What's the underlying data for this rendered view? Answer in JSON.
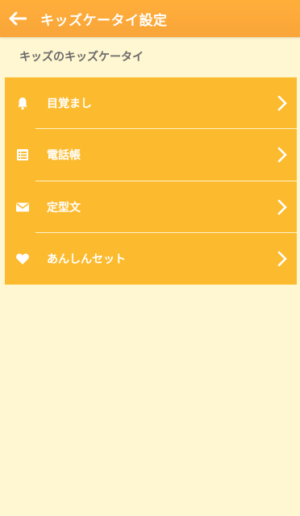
{
  "header": {
    "title": "キッズケータイ設定",
    "back_icon": "arrow-left-icon"
  },
  "section": {
    "title": "キッズのキッズケータイ"
  },
  "menu": {
    "items": [
      {
        "label": "目覚まし",
        "icon": "bell-icon"
      },
      {
        "label": "電話帳",
        "icon": "contacts-list-icon"
      },
      {
        "label": "定型文",
        "icon": "envelope-icon"
      },
      {
        "label": "あんしんセット",
        "icon": "heart-icon"
      }
    ]
  },
  "colors": {
    "app_bar": "#f9a53a",
    "background": "#fff7d1",
    "menu": "#fcbb2f",
    "text_on_menu": "#ffffff"
  }
}
